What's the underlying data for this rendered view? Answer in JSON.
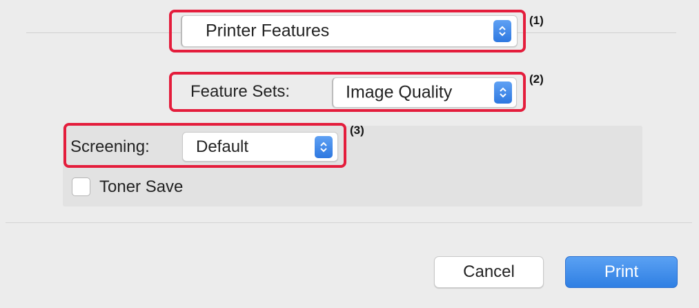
{
  "colors": {
    "highlight": "#e41d3c",
    "accent": "#3583e8",
    "background": "#ececec",
    "panel": "#e2e2e2"
  },
  "presets_popup": {
    "value": "Printer Features",
    "callout": "(1)",
    "icon": "chevron-updown-icon"
  },
  "feature_sets": {
    "label": "Feature Sets:",
    "value": "Image Quality",
    "callout": "(2)",
    "icon": "chevron-updown-icon"
  },
  "screening": {
    "label": "Screening:",
    "value": "Default",
    "callout": "(3)",
    "icon": "chevron-updown-icon"
  },
  "toner_save": {
    "label": "Toner Save",
    "checked": false
  },
  "buttons": {
    "cancel": "Cancel",
    "print": "Print"
  }
}
